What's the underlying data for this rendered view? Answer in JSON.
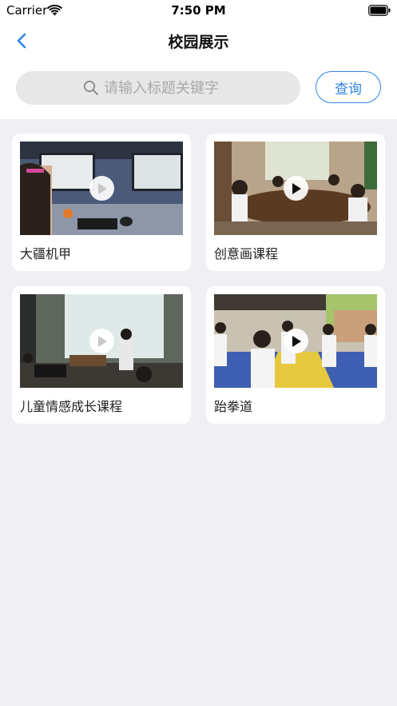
{
  "status_bar": {
    "carrier": "Carrier",
    "time": "7:50 PM"
  },
  "nav": {
    "title": "校园展示",
    "back_icon": "chevron-left-icon"
  },
  "search": {
    "placeholder": "请输入标题关键字",
    "value": "",
    "button_label": "查询"
  },
  "colors": {
    "accent": "#2f86e0",
    "page_background": "#efeff4"
  },
  "videos": [
    {
      "title": "大疆机甲"
    },
    {
      "title": "创意画课程"
    },
    {
      "title": "儿童情感成长课程"
    },
    {
      "title": "跆拳道"
    }
  ]
}
